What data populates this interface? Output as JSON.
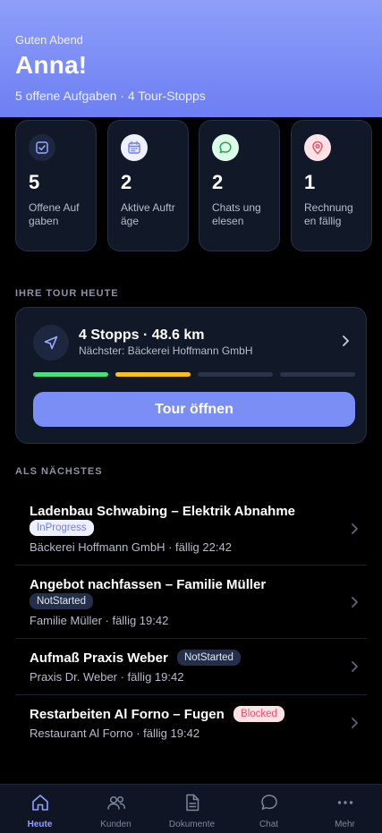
{
  "header": {
    "greeting": "Guten Abend",
    "name": "Anna!",
    "summary": "5 offene Aufgaben · 4 Tour-Stopps"
  },
  "stats": [
    {
      "icon": "checkbox-icon",
      "value": "5",
      "label": "Offene Aufgaben",
      "icon_bg": "#1e2740",
      "icon_color": "#9aa8ff"
    },
    {
      "icon": "calendar-icon",
      "value": "2",
      "label": "Aktive Aufträge",
      "icon_bg": "#eef0ff",
      "icon_color": "#6c7df1"
    },
    {
      "icon": "chat-bubble-icon",
      "value": "2",
      "label": "Chats ungelesen",
      "icon_bg": "#dcfce7",
      "icon_color": "#22a55a"
    },
    {
      "icon": "location-pin-icon",
      "value": "1",
      "label": "Rechnungen fällig",
      "icon_bg": "#fde2e6",
      "icon_color": "#e8536d"
    }
  ],
  "tour_section_title": "IHRE TOUR HEUTE",
  "tour": {
    "title": "4 Stopps · 48.6 km",
    "next": "Nächster: Bäckerei Hoffmann GmbH",
    "button_label": "Tour öffnen",
    "segments": [
      "#4ade80",
      "#fbbf24",
      "#2a3347",
      "#2a3347"
    ]
  },
  "next_section_title": "ALS NÄCHSTES",
  "tasks": [
    {
      "title": "Ladenbau Schwabing – Elektrik Abnahme",
      "status": "InProgress",
      "meta": "Bäckerei Hoffmann GmbH · fällig 22:42"
    },
    {
      "title": "Angebot nachfassen – Familie Müller",
      "status": "NotStarted",
      "meta": "Familie Müller · fällig 19:42"
    },
    {
      "title": "Aufmaß Praxis Weber",
      "status": "NotStarted",
      "meta": "Praxis Dr. Weber · fällig 19:42"
    },
    {
      "title": "Restarbeiten Al Forno – Fugen",
      "status": "Blocked",
      "meta": "Restaurant Al Forno · fällig 19:42"
    }
  ],
  "nav": {
    "active_color": "#8fa0ff",
    "items": [
      {
        "label": "Heute",
        "icon": "home-icon",
        "active": true
      },
      {
        "label": "Kunden",
        "icon": "users-icon",
        "active": false
      },
      {
        "label": "Dokumente",
        "icon": "document-icon",
        "active": false
      },
      {
        "label": "Chat",
        "icon": "chat-icon",
        "active": false
      },
      {
        "label": "Mehr",
        "icon": "more-dots-icon",
        "active": false
      }
    ]
  }
}
